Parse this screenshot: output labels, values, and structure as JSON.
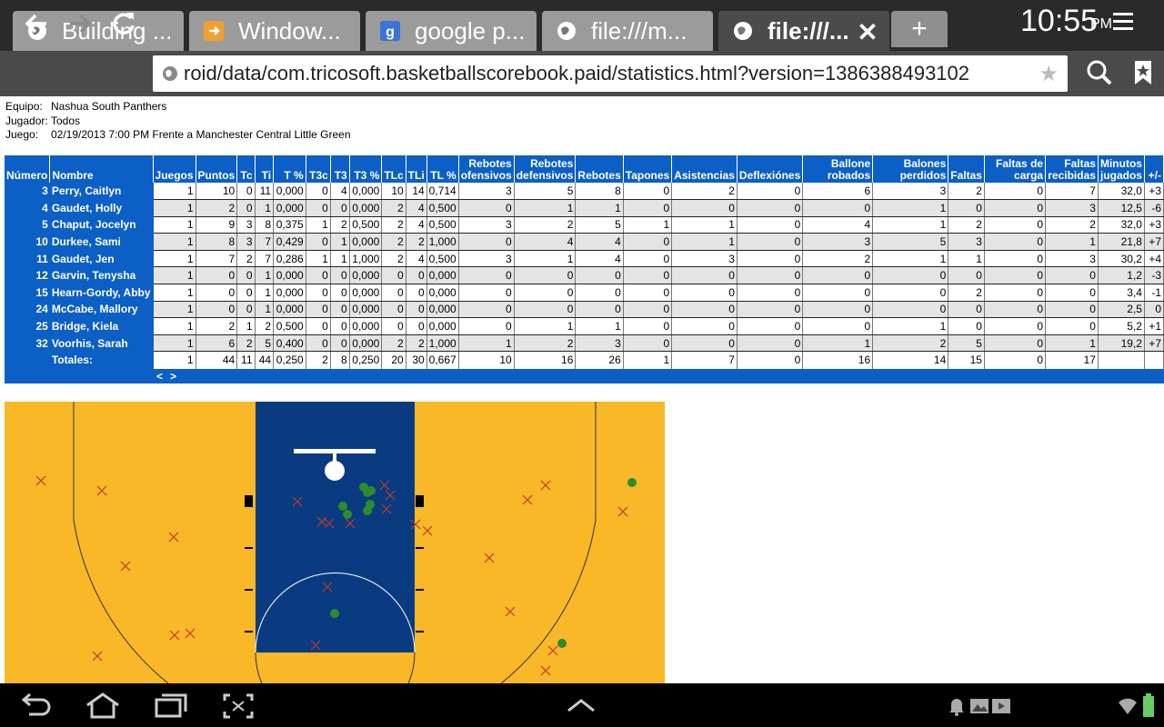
{
  "browser": {
    "tabs": [
      {
        "label": "Building ...",
        "icon": "globe-icon",
        "active": false
      },
      {
        "label": "Window...",
        "icon": "orange-arrow-icon",
        "active": false
      },
      {
        "label": "google p...",
        "icon": "google-icon",
        "active": false
      },
      {
        "label": "file:///m...",
        "icon": "globe-icon",
        "active": false
      },
      {
        "label": "file:///...",
        "icon": "globe-icon",
        "active": true
      }
    ],
    "new_tab_label": "+",
    "close_label": "✕",
    "url": "roid/data/com.tricosoft.basketballscorebook.paid/statistics.html?version=1386388493102"
  },
  "meta": {
    "team_label": "Equipo:",
    "team": "Nashua South Panthers",
    "player_label": "Jugador:",
    "player": "Todos",
    "game_label": "Juego:",
    "game": "02/19/2013 7:00 PM Frente a Manchester Central Little Green"
  },
  "table": {
    "headers": [
      "Número",
      "Nombre",
      "Juegos",
      "Puntos",
      "Tc",
      "Ti",
      "T %",
      "T3c",
      "T3",
      "T3 %",
      "TLc",
      "TLi",
      "TL %",
      "Rebotes ofensivos",
      "Rebotes defensivos",
      "Rebotes",
      "Tapones",
      "Asistencias",
      "Deflexiónes",
      "Ballone robados",
      "Balones perdidos",
      "Faltas",
      "Faltas de carga",
      "Faltas recibidas",
      "Minutos jugados",
      "+/-"
    ],
    "rows": [
      [
        "3",
        "Perry, Caitlyn",
        "1",
        "10",
        "0",
        "11",
        "0,000",
        "0",
        "4",
        "0,000",
        "10",
        "14",
        "0,714",
        "3",
        "5",
        "8",
        "0",
        "2",
        "0",
        "6",
        "3",
        "2",
        "0",
        "7",
        "32,0",
        "+3"
      ],
      [
        "4",
        "Gaudet, Holly",
        "1",
        "2",
        "0",
        "1",
        "0,000",
        "0",
        "0",
        "0,000",
        "2",
        "4",
        "0,500",
        "0",
        "1",
        "1",
        "0",
        "0",
        "0",
        "0",
        "1",
        "0",
        "0",
        "3",
        "12,5",
        "-6"
      ],
      [
        "5",
        "Chaput, Jocelyn",
        "1",
        "9",
        "3",
        "8",
        "0,375",
        "1",
        "2",
        "0,500",
        "2",
        "4",
        "0,500",
        "3",
        "2",
        "5",
        "1",
        "1",
        "0",
        "4",
        "1",
        "2",
        "0",
        "2",
        "32,0",
        "+3"
      ],
      [
        "10",
        "Durkee, Sami",
        "1",
        "8",
        "3",
        "7",
        "0,429",
        "0",
        "1",
        "0,000",
        "2",
        "2",
        "1,000",
        "0",
        "4",
        "4",
        "0",
        "1",
        "0",
        "3",
        "5",
        "3",
        "0",
        "1",
        "21,8",
        "+7"
      ],
      [
        "11",
        "Gaudet, Jen",
        "1",
        "7",
        "2",
        "7",
        "0,286",
        "1",
        "1",
        "1,000",
        "2",
        "4",
        "0,500",
        "3",
        "1",
        "4",
        "0",
        "3",
        "0",
        "2",
        "1",
        "1",
        "0",
        "3",
        "30,2",
        "+4"
      ],
      [
        "12",
        "Garvin, Tenysha",
        "1",
        "0",
        "0",
        "1",
        "0,000",
        "0",
        "0",
        "0,000",
        "0",
        "0",
        "0,000",
        "0",
        "0",
        "0",
        "0",
        "0",
        "0",
        "0",
        "0",
        "0",
        "0",
        "0",
        "1,2",
        "-3"
      ],
      [
        "15",
        "Hearn-Gordy, Abby",
        "1",
        "0",
        "0",
        "1",
        "0,000",
        "0",
        "0",
        "0,000",
        "0",
        "0",
        "0,000",
        "0",
        "0",
        "0",
        "0",
        "0",
        "0",
        "0",
        "0",
        "2",
        "0",
        "0",
        "3,4",
        "-1"
      ],
      [
        "24",
        "McCabe, Mallory",
        "1",
        "0",
        "0",
        "1",
        "0,000",
        "0",
        "0",
        "0,000",
        "0",
        "0",
        "0,000",
        "0",
        "0",
        "0",
        "0",
        "0",
        "0",
        "0",
        "0",
        "0",
        "0",
        "0",
        "2,5",
        "0"
      ],
      [
        "25",
        "Bridge, Kiela",
        "1",
        "2",
        "1",
        "2",
        "0,500",
        "0",
        "0",
        "0,000",
        "0",
        "0",
        "0,000",
        "0",
        "1",
        "1",
        "0",
        "0",
        "0",
        "0",
        "1",
        "0",
        "0",
        "0",
        "5,2",
        "+1"
      ],
      [
        "32",
        "Voorhis, Sarah",
        "1",
        "6",
        "2",
        "5",
        "0,400",
        "0",
        "0",
        "0,000",
        "2",
        "2",
        "1,000",
        "1",
        "2",
        "3",
        "0",
        "0",
        "0",
        "1",
        "2",
        "5",
        "0",
        "1",
        "19,2",
        "+7"
      ]
    ],
    "totals": [
      "",
      "Totales:",
      "1",
      "44",
      "11",
      "44",
      "0,250",
      "2",
      "8",
      "0,250",
      "20",
      "30",
      "0,667",
      "10",
      "16",
      "26",
      "1",
      "7",
      "0",
      "16",
      "14",
      "15",
      "0",
      "17",
      "",
      ""
    ],
    "pager_prev": "<",
    "pager_next": ">"
  },
  "shot_chart": {
    "colors": {
      "court": "#f8b827",
      "paint": "#0a3b80",
      "made": "#2e8b2e",
      "missed": "#c0392b"
    }
  },
  "system": {
    "time": "10:55",
    "ampm": "PM"
  }
}
